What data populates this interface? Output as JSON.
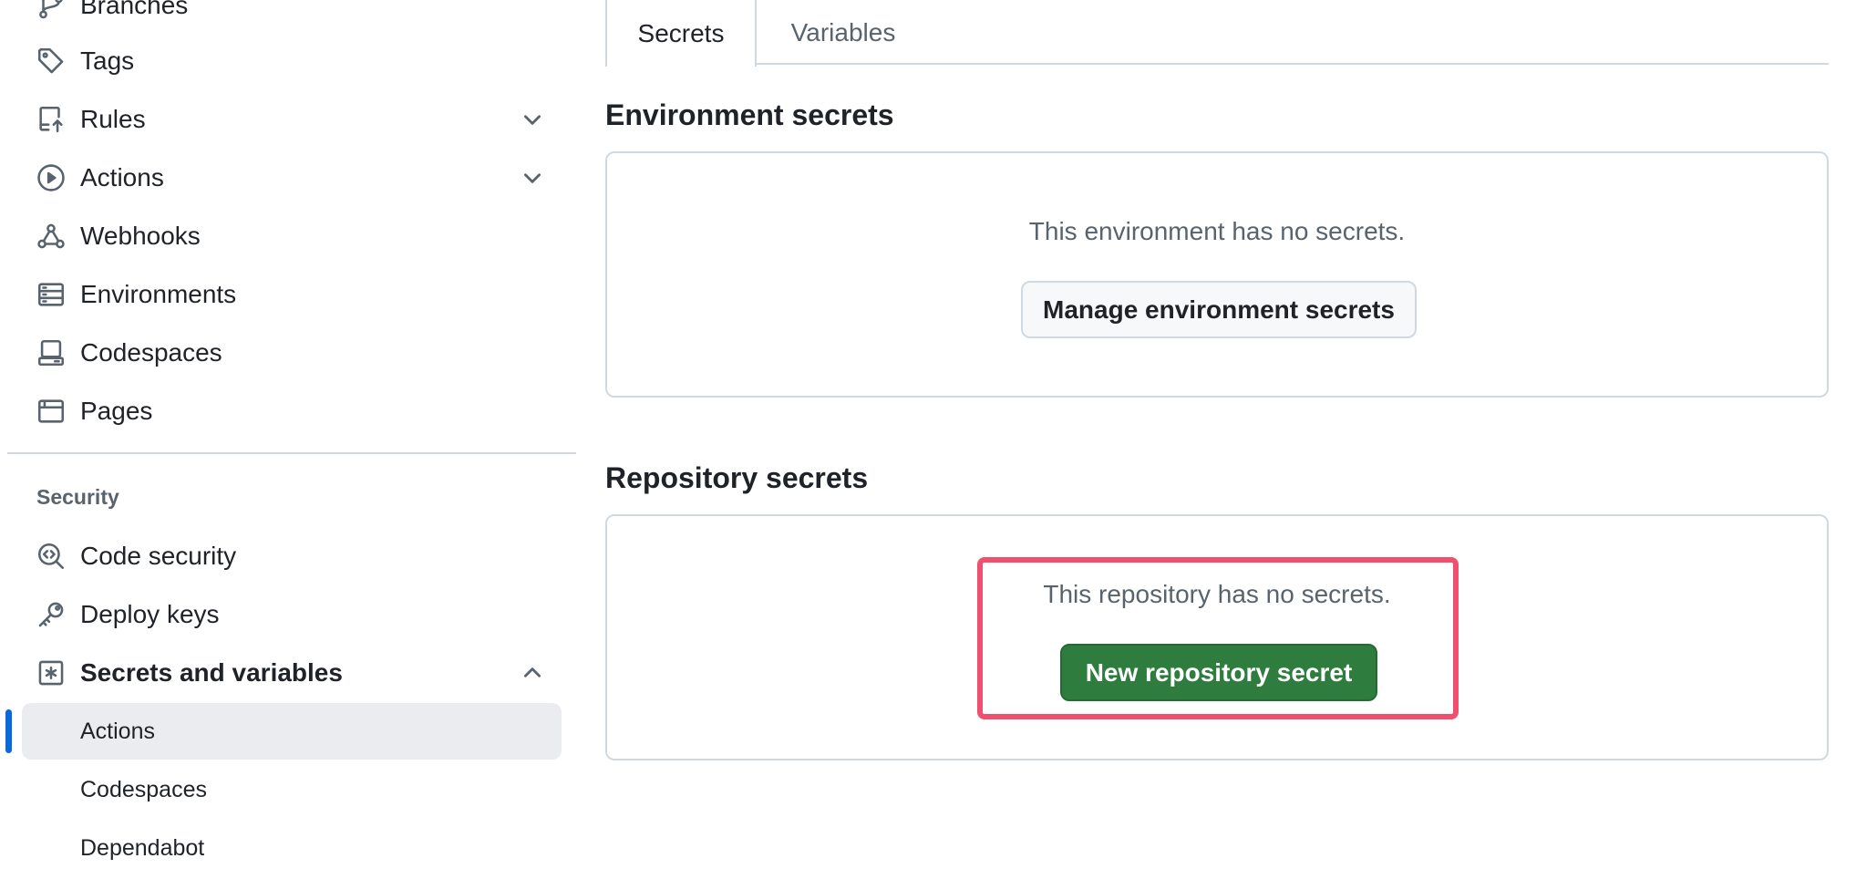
{
  "sidebar": {
    "items": [
      {
        "label": "Branches",
        "icon": "branch-icon"
      },
      {
        "label": "Tags",
        "icon": "tag-icon"
      },
      {
        "label": "Rules",
        "icon": "rules-icon",
        "expandable": true
      },
      {
        "label": "Actions",
        "icon": "play-icon",
        "expandable": true
      },
      {
        "label": "Webhooks",
        "icon": "webhook-icon"
      },
      {
        "label": "Environments",
        "icon": "server-icon"
      },
      {
        "label": "Codespaces",
        "icon": "codespaces-icon"
      },
      {
        "label": "Pages",
        "icon": "browser-icon"
      }
    ],
    "security_heading": "Security",
    "security_items": [
      {
        "label": "Code security",
        "icon": "codescan-icon"
      },
      {
        "label": "Deploy keys",
        "icon": "key-icon"
      },
      {
        "label": "Secrets and variables",
        "icon": "asterisk-icon",
        "expanded": true
      }
    ],
    "sub_items": [
      {
        "label": "Actions",
        "active": true
      },
      {
        "label": "Codespaces"
      },
      {
        "label": "Dependabot"
      }
    ]
  },
  "tabs": {
    "secrets": "Secrets",
    "variables": "Variables",
    "selected": "Secrets"
  },
  "environment": {
    "title": "Environment secrets",
    "empty_text": "This environment has no secrets.",
    "button_label": "Manage environment secrets"
  },
  "repository": {
    "title": "Repository secrets",
    "empty_text": "This repository has no secrets.",
    "button_label": "New repository secret"
  },
  "colors": {
    "accent_bar": "#0969da",
    "primary_button": "#2f7d3e",
    "highlight_border": "#f0506e"
  }
}
